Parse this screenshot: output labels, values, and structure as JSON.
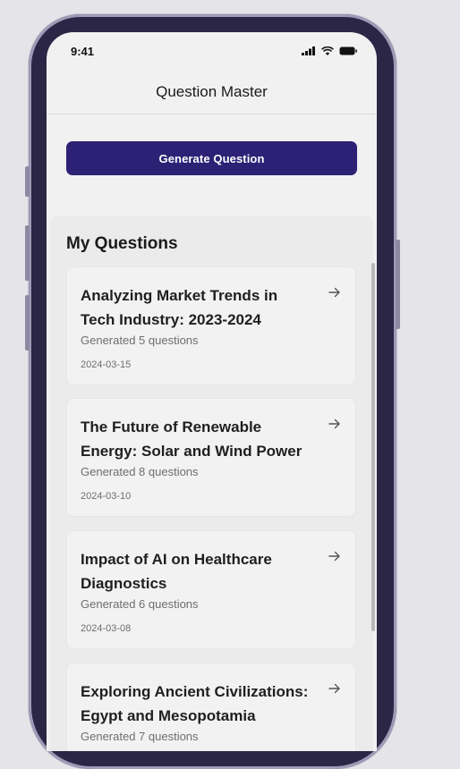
{
  "status_bar": {
    "time": "9:41",
    "icons": [
      "signal-icon",
      "wifi-icon",
      "battery-icon"
    ]
  },
  "nav": {
    "title": "Question Master"
  },
  "generate_button": {
    "label": "Generate Question"
  },
  "section": {
    "title": "My Questions"
  },
  "cards": [
    {
      "title": "Analyzing Market Trends in Tech Industry: 2023-2024",
      "count": "Generated 5 questions",
      "date": "2024-03-15"
    },
    {
      "title": "The Future of Renewable Energy: Solar and Wind Power",
      "count": "Generated 8 questions",
      "date": "2024-03-10"
    },
    {
      "title": "Impact of AI on Healthcare Diagnostics",
      "count": "Generated 6 questions",
      "date": "2024-03-08"
    },
    {
      "title": "Exploring Ancient Civilizations: Egypt and Mesopotamia",
      "count": "Generated 7 questions",
      "date": ""
    }
  ],
  "colors": {
    "accent": "#2c2175",
    "background": "#e5e4e9",
    "phone_frame": "#2b2645",
    "screen": "#f1f1f1"
  }
}
